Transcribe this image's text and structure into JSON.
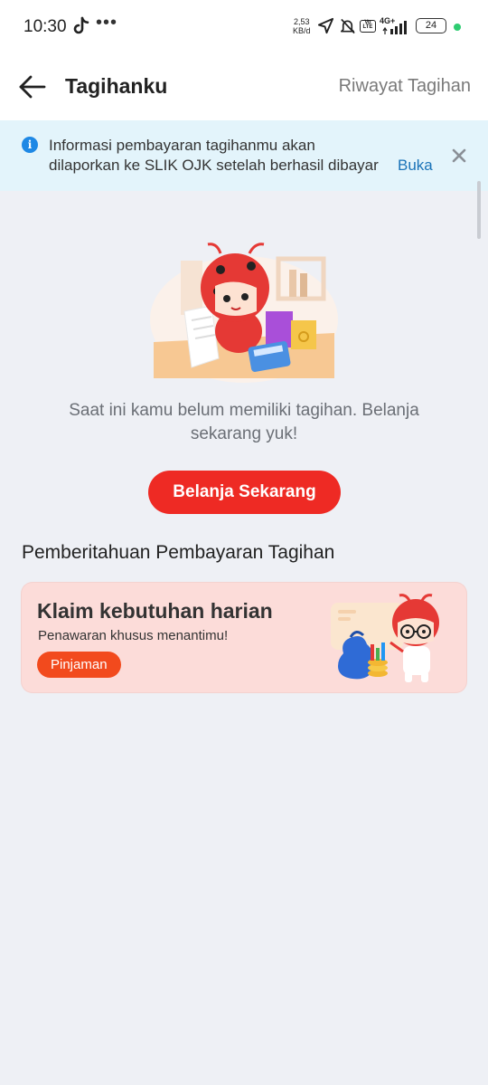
{
  "status_bar": {
    "time": "10:30",
    "net_speed_value": "2,53",
    "net_speed_unit": "KB/d",
    "volte": "Vo LTE",
    "network": "4G+",
    "battery": "24",
    "icons": [
      "tiktok-icon",
      "more-dots-icon",
      "location-arrow-icon",
      "bell-off-icon",
      "signal-icon"
    ]
  },
  "header": {
    "title": "Tagihanku",
    "history_link": "Riwayat Tagihan"
  },
  "notice": {
    "line1": "Informasi pembayaran tagihanmu akan",
    "line2": "dilaporkan ke SLIK OJK setelah berhasil dibayar",
    "open_label": "Buka"
  },
  "empty_state": {
    "message": "Saat ini kamu belum memiliki tagihan. Belanja sekarang yuk!",
    "cta_label": "Belanja Sekarang"
  },
  "payment_notice": {
    "section_title": "Pemberitahuan Pembayaran Tagihan",
    "promo": {
      "title": "Klaim kebutuhan harian",
      "subtitle": "Penawaran khusus menantimu!",
      "tag": "Pinjaman"
    }
  },
  "colors": {
    "accent_red": "#ee2a24",
    "promo_tag": "#f24a1d",
    "promo_bg": "#fcdcd9",
    "notice_bg": "#e3f4fb",
    "link_blue": "#1a73b8"
  }
}
